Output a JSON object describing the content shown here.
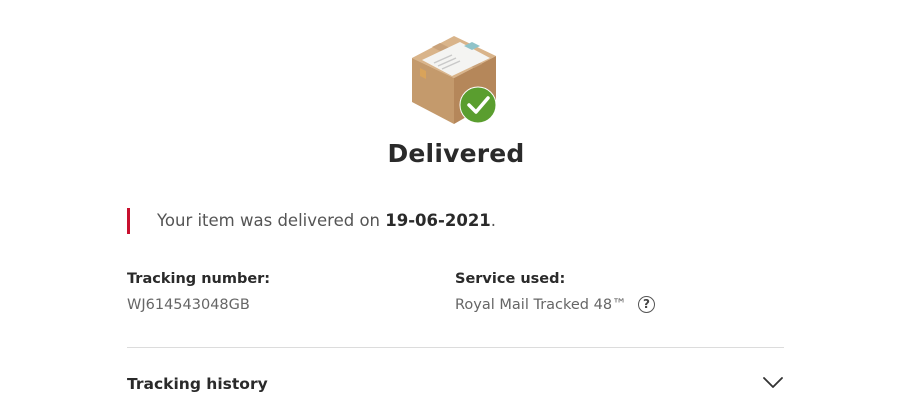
{
  "status": {
    "title": "Delivered",
    "icon": "package-delivered-icon",
    "check_color": "#5a9e2f"
  },
  "notice": {
    "prefix": "Your item was delivered on ",
    "date": "19-06-2021",
    "suffix": ".",
    "accent_color": "#c8102e"
  },
  "tracking": {
    "label": "Tracking number:",
    "value": "WJ614543048GB"
  },
  "service": {
    "label": "Service used:",
    "value": "Royal Mail Tracked 48™",
    "help_icon": "question-circle-icon",
    "help_glyph": "?"
  },
  "history": {
    "label": "Tracking history",
    "toggle_icon": "chevron-down-icon"
  }
}
